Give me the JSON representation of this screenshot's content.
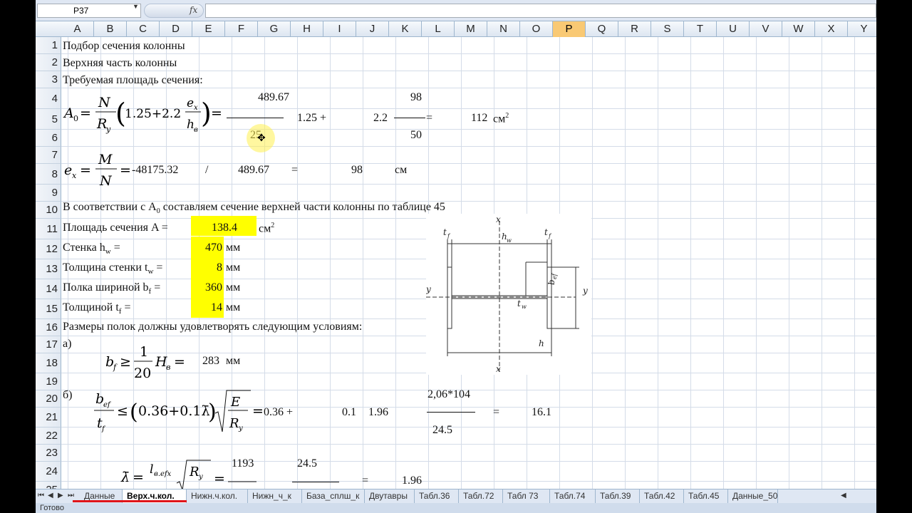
{
  "formula_bar": {
    "name_box": "P37",
    "fx_label": "fx",
    "formula": ""
  },
  "columns": [
    "A",
    "B",
    "C",
    "D",
    "E",
    "F",
    "G",
    "H",
    "I",
    "J",
    "K",
    "L",
    "M",
    "N",
    "O",
    "P",
    "Q",
    "R",
    "S",
    "T",
    "U",
    "V",
    "W",
    "X",
    "Y"
  ],
  "selected_column": "P",
  "rows": [
    "1",
    "2",
    "3",
    "4",
    "5",
    "6",
    "7",
    "8",
    "9",
    "10",
    "11",
    "12",
    "13",
    "14",
    "15",
    "16",
    "17",
    "18",
    "19",
    "20",
    "21",
    "22",
    "23",
    "24",
    "25"
  ],
  "cells": {
    "r1": "Подбор сечения колонны",
    "r2": "Верхняя часть колонны",
    "r3": "Требуемая площадь сечения:",
    "r4_num": "489.67",
    "r4_j": "98",
    "r5_h": "1.25 +",
    "r5_j": "2.2",
    "r5_eq": "=",
    "r5_val": "112",
    "r5_unit": "см",
    "r5_unit_sup": "2",
    "r6_den": "25",
    "r6_j": "50",
    "r8_d": "-48175.32",
    "r8_slash": "/",
    "r8_f": "489.67",
    "r8_eq": "=",
    "r8_val": "98",
    "r8_unit": "см",
    "r10_a": "В соответствии с A",
    "r10_sub": "0",
    "r10_b": " составляем сечение верхней части колонны по таблице 45",
    "r11_label": "Площадь сечения A =",
    "r11_val": "138.4",
    "r11_unit": "см",
    "r11_unit_sup": "2",
    "r12_label": "Стенка h",
    "r12_sub": "w",
    "r12_eq": " =",
    "r12_val": "470",
    "r12_unit": "мм",
    "r13_label": "Толщина стенки t",
    "r13_sub": "w",
    "r13_eq": " =",
    "r13_val": "8",
    "r13_unit": "мм",
    "r14_label": "Полка шириной b",
    "r14_sub": "f",
    "r14_eq": " =",
    "r14_val": "360",
    "r14_unit": "мм",
    "r15_label": "Толщиной t",
    "r15_sub": "f",
    "r15_eq": " =",
    "r15_val": "14",
    "r15_unit": "мм",
    "r16": "Размеры полок должны удовлетворять следующим условиям:",
    "r17": "а)",
    "r18_val": "283",
    "r18_unit": "мм",
    "r20": "б)",
    "r20_num": "2,06*104",
    "r21_a": "0.36 +",
    "r21_b": "0.1",
    "r21_c": "1.96",
    "r21_eq": "=",
    "r21_val": "16.1",
    "r22_den": "24.5",
    "r24_a": "1193",
    "r24_b": "24.5",
    "r25_eq": "=",
    "r25_val": "1.96"
  },
  "diagram_labels": {
    "tf_left": "t",
    "tf_right": "t",
    "f": "f",
    "hw": "h",
    "w": "w",
    "x_top": "x",
    "x_bottom": "x",
    "y_left": "y",
    "y_right": "y",
    "bef": "b",
    "ef": "ef",
    "bf": "b",
    "tw": "t",
    "h": "h"
  },
  "tabs": [
    "Данные",
    "Верх.ч.кол.",
    "Нижн.ч.кол.",
    "Нижн_ч_к",
    "База_сплш_к",
    "Двутавры",
    "Табл.36",
    "Табл.72",
    "Табл 73",
    "Табл.74",
    "Табл.39",
    "Табл.42",
    "Табл.45",
    "Данные_50"
  ],
  "active_tab": "Верх.ч.кол.",
  "status": "Готово",
  "colors": {
    "highlight": "#ffff00",
    "selected_header": "#f9c974",
    "underline": "#e0151a"
  }
}
